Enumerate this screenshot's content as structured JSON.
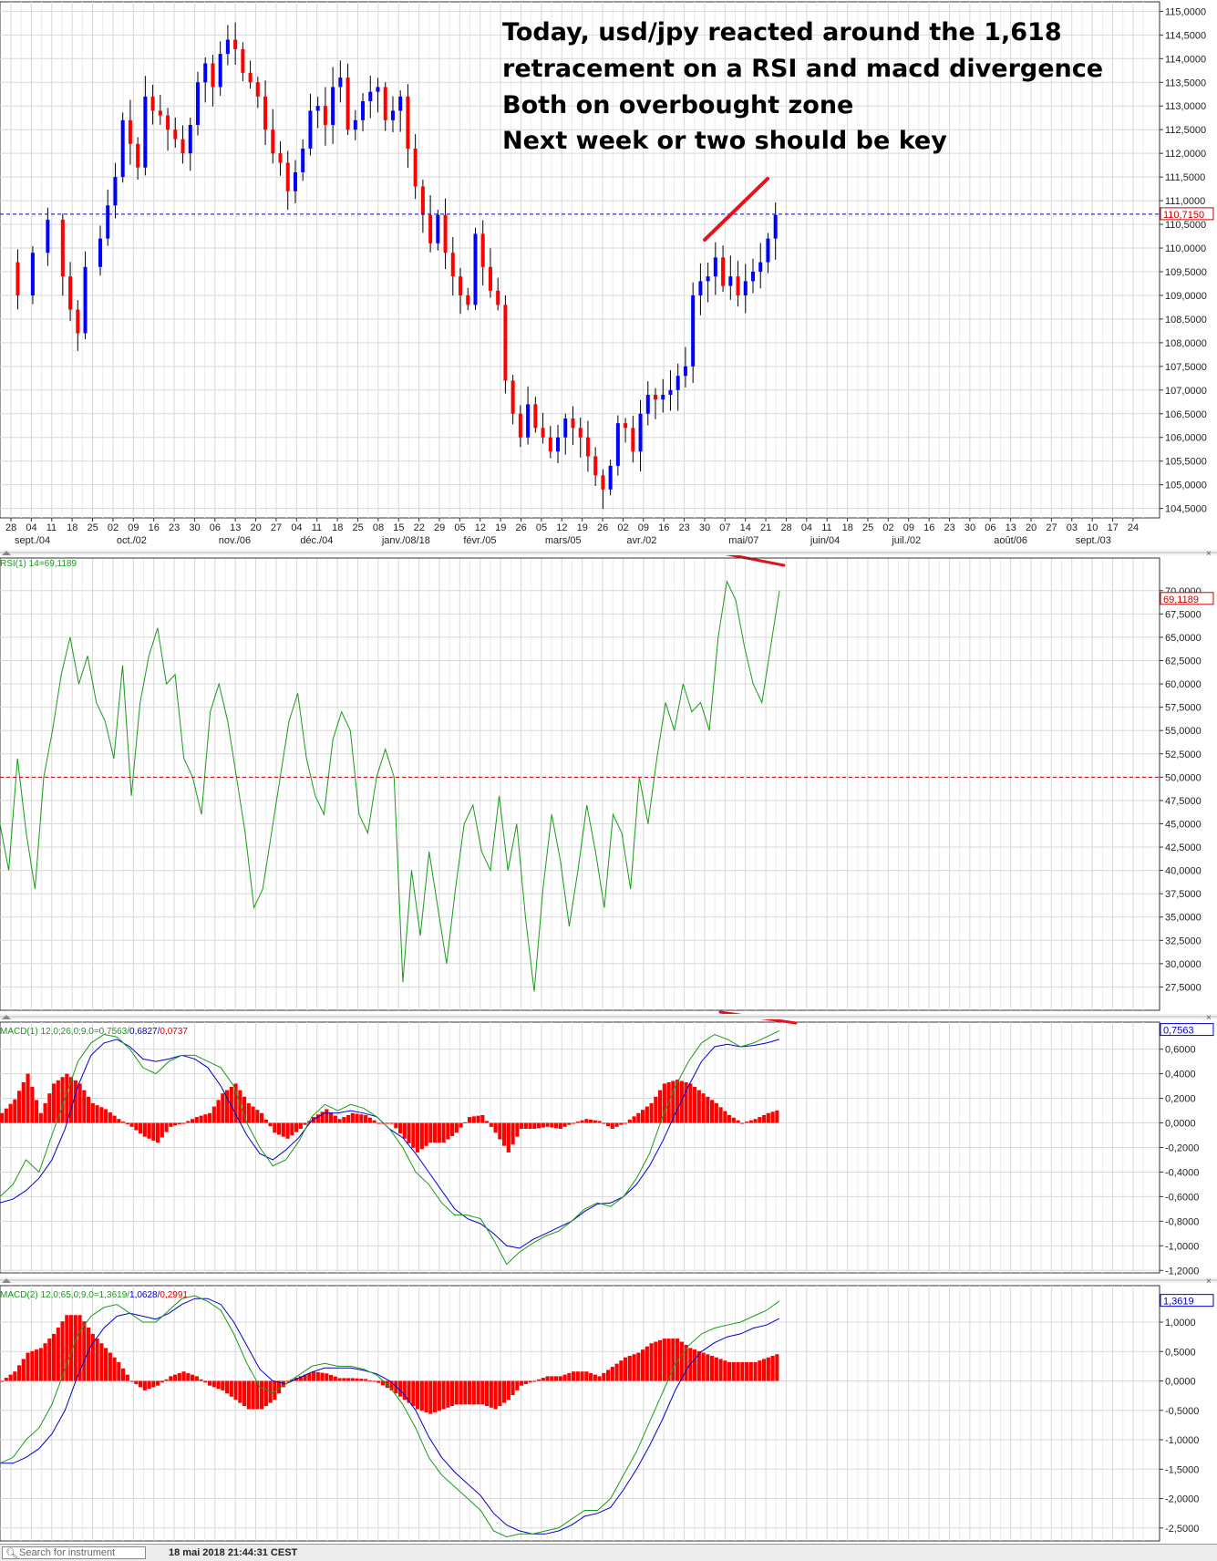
{
  "annotation": {
    "lines": [
      "Today, usd/jpy reacted around the 1,618",
      "retracement on a RSI and macd divergence",
      "Both on overbought zone",
      "Next week or two should be key"
    ]
  },
  "status_bar": {
    "search_placeholder": "Search for instrument",
    "timestamp": "18 mai 2018 21:44:31 CEST"
  },
  "colors": {
    "up": "#0000ff",
    "down": "#ff0000",
    "rsi": "#1a9a1a",
    "macd": "#1a9a1a",
    "signal": "#0000cc",
    "hist": "#ff0000",
    "grid": "#d8d8d8",
    "ref_line_price": "#0000cc",
    "ref_line_rsi": "#cc0000",
    "trend_marks": "#e8101a"
  },
  "chart_data": [
    {
      "type": "candlestick",
      "title": "",
      "date_ticks": [
        "28",
        "04",
        "11",
        "18",
        "25",
        "02",
        "09",
        "16",
        "23",
        "30",
        "06",
        "13",
        "20",
        "27",
        "04",
        "11",
        "18",
        "25",
        "08",
        "15",
        "22",
        "29",
        "05",
        "12",
        "19",
        "26",
        "05",
        "12",
        "19",
        "26",
        "02",
        "09",
        "16",
        "23",
        "30",
        "07",
        "14",
        "21",
        "28",
        "04",
        "11",
        "18",
        "25",
        "02",
        "09",
        "16",
        "23",
        "30",
        "06",
        "13",
        "20",
        "27",
        "03",
        "10",
        "17",
        "24"
      ],
      "month_labels": [
        "sept./04",
        "oct./02",
        "nov./06",
        "déc./04",
        "janv./08/18",
        "févr./05",
        "mars/05",
        "avr./02",
        "mai/07",
        "juin/04",
        "juil./02",
        "août/06",
        "sept./03"
      ],
      "y_ticks": [
        "115,0000",
        "114,5000",
        "114,0000",
        "113,5000",
        "113,0000",
        "112,5000",
        "112,0000",
        "111,5000",
        "111,0000",
        "110,5000",
        "110,0000",
        "109,5000",
        "109,0000",
        "108,5000",
        "108,0000",
        "107,5000",
        "107,0000",
        "106,5000",
        "106,0000",
        "105,5000",
        "105,0000",
        "104,5000"
      ],
      "ylim": [
        104.3,
        115.2
      ],
      "last_value_label": "110,7150",
      "last_value": 110.715,
      "close_path": [
        [
          0,
          109.7
        ],
        [
          2,
          109.0
        ],
        [
          4,
          109.9
        ],
        [
          6,
          110.6
        ],
        [
          8,
          109.4
        ],
        [
          9,
          108.7
        ],
        [
          10,
          108.2
        ],
        [
          11,
          109.6
        ],
        [
          13,
          110.2
        ],
        [
          14,
          110.9
        ],
        [
          15,
          111.5
        ],
        [
          16,
          112.7
        ],
        [
          17,
          112.2
        ],
        [
          18,
          111.7
        ],
        [
          19,
          113.2
        ],
        [
          20,
          112.9
        ],
        [
          21,
          112.8
        ],
        [
          22,
          112.5
        ],
        [
          23,
          112.3
        ],
        [
          24,
          112.0
        ],
        [
          25,
          112.6
        ],
        [
          26,
          113.5
        ],
        [
          27,
          113.9
        ],
        [
          28,
          113.4
        ],
        [
          29,
          114.1
        ],
        [
          30,
          114.4
        ],
        [
          31,
          114.2
        ],
        [
          32,
          113.7
        ],
        [
          33,
          113.5
        ],
        [
          34,
          113.2
        ],
        [
          35,
          112.5
        ],
        [
          36,
          112.0
        ],
        [
          37,
          111.8
        ],
        [
          38,
          111.2
        ],
        [
          39,
          111.6
        ],
        [
          40,
          112.1
        ],
        [
          41,
          112.9
        ],
        [
          42,
          113.0
        ],
        [
          43,
          112.6
        ],
        [
          44,
          113.4
        ],
        [
          45,
          113.6
        ],
        [
          46,
          112.5
        ],
        [
          47,
          112.7
        ],
        [
          48,
          113.1
        ],
        [
          49,
          113.3
        ],
        [
          50,
          113.4
        ],
        [
          51,
          112.7
        ],
        [
          52,
          112.9
        ],
        [
          53,
          113.2
        ],
        [
          54,
          112.1
        ],
        [
          55,
          111.3
        ],
        [
          56,
          110.7
        ],
        [
          57,
          110.1
        ],
        [
          58,
          110.7
        ],
        [
          59,
          109.9
        ],
        [
          60,
          109.4
        ],
        [
          61,
          109.0
        ],
        [
          62,
          108.8
        ],
        [
          63,
          110.3
        ],
        [
          64,
          109.6
        ],
        [
          65,
          109.1
        ],
        [
          66,
          108.8
        ],
        [
          67,
          107.2
        ],
        [
          68,
          106.5
        ],
        [
          69,
          106.0
        ],
        [
          70,
          106.7
        ],
        [
          71,
          106.2
        ],
        [
          72,
          106.0
        ],
        [
          73,
          105.7
        ],
        [
          74,
          106.0
        ],
        [
          75,
          106.4
        ],
        [
          76,
          106.2
        ],
        [
          77,
          106.0
        ],
        [
          78,
          105.6
        ],
        [
          79,
          105.2
        ],
        [
          80,
          104.9
        ],
        [
          81,
          105.4
        ],
        [
          82,
          106.3
        ],
        [
          83,
          106.2
        ],
        [
          84,
          105.7
        ],
        [
          85,
          106.5
        ],
        [
          86,
          106.9
        ],
        [
          87,
          106.8
        ],
        [
          88,
          106.9
        ],
        [
          89,
          107.0
        ],
        [
          90,
          107.3
        ],
        [
          91,
          107.5
        ],
        [
          92,
          109.0
        ],
        [
          93,
          109.3
        ],
        [
          94,
          109.4
        ],
        [
          95,
          109.8
        ],
        [
          96,
          109.2
        ],
        [
          97,
          109.4
        ],
        [
          98,
          109.0
        ],
        [
          99,
          109.3
        ],
        [
          100,
          109.5
        ],
        [
          101,
          109.7
        ],
        [
          102,
          110.2
        ],
        [
          103,
          110.7
        ]
      ]
    },
    {
      "type": "line",
      "title": "RSI(1) 14=69,1189",
      "series": [
        {
          "name": "RSI(1) 14",
          "last": 69.1189
        }
      ],
      "y_ticks": [
        "70,0000",
        "67,5000",
        "65,0000",
        "62,5000",
        "60,0000",
        "57,5000",
        "55,0000",
        "52,5000",
        "50,0000",
        "47,5000",
        "45,0000",
        "42,5000",
        "40,0000",
        "37,5000",
        "35,0000",
        "32,5000",
        "30,0000",
        "27,5000"
      ],
      "ylim": [
        25.0,
        73.5
      ],
      "reference_line": 50,
      "last_value_label": "69,1189",
      "values": [
        45,
        40,
        52,
        44,
        38,
        50,
        55,
        61,
        65,
        60,
        63,
        58,
        56,
        52,
        62,
        48,
        58,
        63,
        66,
        60,
        61,
        52,
        50,
        46,
        57,
        60,
        56,
        50,
        44,
        36,
        38,
        44,
        50,
        56,
        59,
        52,
        48,
        46,
        54,
        57,
        55,
        46,
        44,
        50,
        53,
        50,
        28,
        40,
        33,
        42,
        36,
        30,
        38,
        45,
        47,
        42,
        40,
        48,
        40,
        45,
        35,
        27,
        38,
        46,
        41,
        34,
        40,
        47,
        42,
        36,
        46,
        44,
        38,
        50,
        45,
        52,
        58,
        55,
        60,
        57,
        58,
        55,
        65,
        71,
        69,
        64,
        60,
        58,
        64,
        70
      ]
    },
    {
      "type": "line",
      "title": "MACD(1) 12,0;26,0;9,0=0,7563/0,6827/0,0737",
      "series": [
        {
          "name": "MACD",
          "last": 0.7563
        },
        {
          "name": "Signal",
          "last": 0.6827
        },
        {
          "name": "Histogram",
          "last": 0.0737
        }
      ],
      "y_ticks": [
        "0,6000",
        "0,4000",
        "0,2000",
        "0,0000",
        "-0,2000",
        "-0,4000",
        "-0,6000",
        "-0,8000",
        "-1,0000",
        "-1,2000"
      ],
      "ylim": [
        -1.22,
        0.82
      ],
      "last_value_label": "0,7563",
      "macd": [
        -0.6,
        -0.5,
        -0.3,
        -0.4,
        -0.1,
        0.2,
        0.5,
        0.65,
        0.72,
        0.7,
        0.6,
        0.45,
        0.4,
        0.5,
        0.55,
        0.55,
        0.5,
        0.45,
        0.3,
        0.0,
        -0.2,
        -0.35,
        -0.3,
        -0.15,
        0.05,
        0.15,
        0.1,
        0.15,
        0.12,
        0.05,
        -0.05,
        -0.2,
        -0.4,
        -0.5,
        -0.65,
        -0.75,
        -0.75,
        -0.78,
        -0.95,
        -1.15,
        -1.05,
        -0.98,
        -0.92,
        -0.88,
        -0.8,
        -0.7,
        -0.65,
        -0.68,
        -0.6,
        -0.45,
        -0.25,
        0.05,
        0.3,
        0.5,
        0.65,
        0.72,
        0.68,
        0.62,
        0.65,
        0.7,
        0.75
      ],
      "signal": [
        -0.65,
        -0.62,
        -0.55,
        -0.45,
        -0.3,
        -0.05,
        0.3,
        0.55,
        0.65,
        0.68,
        0.62,
        0.52,
        0.5,
        0.52,
        0.55,
        0.52,
        0.45,
        0.3,
        0.1,
        -0.1,
        -0.25,
        -0.3,
        -0.22,
        -0.12,
        0.02,
        0.08,
        0.08,
        0.1,
        0.08,
        0.05,
        -0.05,
        -0.12,
        -0.25,
        -0.4,
        -0.55,
        -0.7,
        -0.78,
        -0.82,
        -0.9,
        -1.0,
        -1.02,
        -0.95,
        -0.9,
        -0.85,
        -0.8,
        -0.72,
        -0.66,
        -0.65,
        -0.6,
        -0.5,
        -0.35,
        -0.15,
        0.08,
        0.3,
        0.5,
        0.62,
        0.64,
        0.62,
        0.63,
        0.65,
        0.68
      ]
    },
    {
      "type": "line",
      "title": "MACD(2) 12,0;65,0;9,0=1,3619/1,0628/0,2991",
      "series": [
        {
          "name": "MACD",
          "last": 1.3619
        },
        {
          "name": "Signal",
          "last": 1.0628
        },
        {
          "name": "Histogram",
          "last": 0.2991
        }
      ],
      "y_ticks": [
        "1,0000",
        "0,5000",
        "0,0000",
        "-0,5000",
        "-1,0000",
        "-1,5000",
        "-2,0000",
        "-2,5000"
      ],
      "ylim": [
        -2.72,
        1.62
      ],
      "last_value_label": "1,3619",
      "macd": [
        -1.4,
        -1.3,
        -1.0,
        -0.8,
        -0.4,
        0.2,
        0.8,
        1.1,
        1.25,
        1.3,
        1.15,
        1.0,
        1.0,
        1.2,
        1.4,
        1.45,
        1.35,
        1.2,
        0.8,
        0.3,
        -0.1,
        -0.2,
        -0.05,
        0.1,
        0.25,
        0.3,
        0.25,
        0.25,
        0.2,
        0.1,
        -0.1,
        -0.4,
        -0.8,
        -1.3,
        -1.6,
        -1.8,
        -2.0,
        -2.2,
        -2.55,
        -2.65,
        -2.6,
        -2.6,
        -2.55,
        -2.5,
        -2.35,
        -2.2,
        -2.2,
        -2.0,
        -1.6,
        -1.2,
        -0.7,
        -0.2,
        0.3,
        0.6,
        0.8,
        0.9,
        0.95,
        1.0,
        1.1,
        1.2,
        1.36
      ],
      "signal": [
        -1.4,
        -1.4,
        -1.3,
        -1.15,
        -0.9,
        -0.5,
        0.1,
        0.6,
        0.9,
        1.1,
        1.15,
        1.1,
        1.05,
        1.15,
        1.3,
        1.4,
        1.4,
        1.3,
        1.0,
        0.6,
        0.2,
        0.0,
        -0.05,
        0.05,
        0.15,
        0.22,
        0.22,
        0.22,
        0.18,
        0.12,
        0.0,
        -0.2,
        -0.5,
        -0.95,
        -1.3,
        -1.55,
        -1.75,
        -1.95,
        -2.25,
        -2.45,
        -2.55,
        -2.6,
        -2.6,
        -2.55,
        -2.45,
        -2.3,
        -2.25,
        -2.15,
        -1.85,
        -1.5,
        -1.1,
        -0.65,
        -0.15,
        0.25,
        0.5,
        0.65,
        0.75,
        0.8,
        0.9,
        0.95,
        1.06
      ]
    }
  ]
}
